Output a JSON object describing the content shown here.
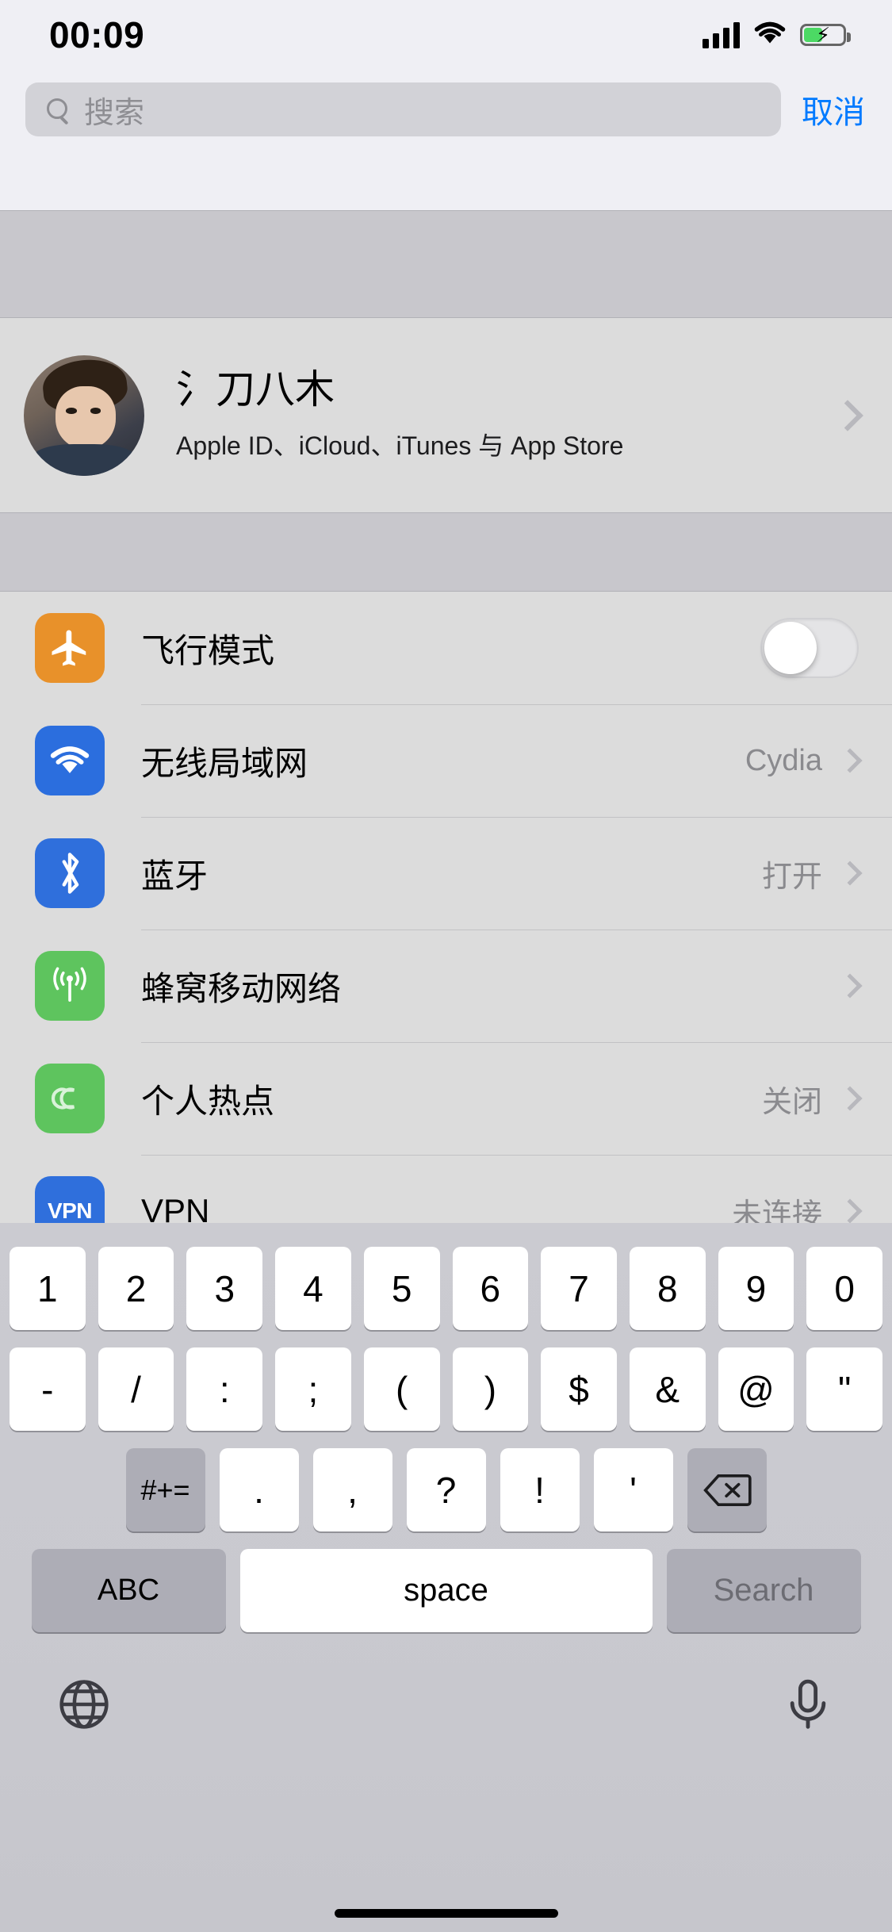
{
  "status_bar": {
    "time": "00:09",
    "signal_icon": "cellular-signal-icon",
    "wifi_icon": "wifi-icon",
    "battery_icon": "battery-charging-icon"
  },
  "search": {
    "placeholder": "搜索",
    "value": "",
    "cancel_label": "取消",
    "icon": "search-icon"
  },
  "profile": {
    "name": "氵刀八木",
    "subtitle": "Apple ID、iCloud、iTunes 与 App Store",
    "avatar": "user-avatar",
    "chevron": "chevron-right-icon"
  },
  "settings": {
    "rows": [
      {
        "label": "飞行模式",
        "value": "",
        "icon": "airplane-icon",
        "icon_color": "#e8912a",
        "control": "toggle",
        "toggle_on": false
      },
      {
        "label": "无线局域网",
        "value": "Cydia",
        "icon": "wifi-icon",
        "icon_color": "#2b6ede",
        "control": "chevron"
      },
      {
        "label": "蓝牙",
        "value": "打开",
        "icon": "bluetooth-icon",
        "icon_color": "#2f6fdc",
        "control": "chevron"
      },
      {
        "label": "蜂窝移动网络",
        "value": "",
        "icon": "cellular-icon",
        "icon_color": "#5ec45e",
        "control": "chevron"
      },
      {
        "label": "个人热点",
        "value": "关闭",
        "icon": "personal-hotspot-icon",
        "icon_color": "#5ec45e",
        "control": "chevron"
      },
      {
        "label": "VPN",
        "value": "未连接",
        "icon": "vpn-icon",
        "icon_color": "#2f6fdc",
        "icon_text": "VPN",
        "control": "chevron"
      }
    ]
  },
  "keyboard": {
    "layout": "numeric-symbols",
    "row1": [
      "1",
      "2",
      "3",
      "4",
      "5",
      "6",
      "7",
      "8",
      "9",
      "0"
    ],
    "row2": [
      "-",
      "/",
      ":",
      ";",
      "(",
      ")",
      "$",
      "&",
      "@",
      "\""
    ],
    "row3": {
      "shift_label": "#+=",
      "keys": [
        ".",
        ",",
        "?",
        "!",
        "'"
      ],
      "backspace_icon": "backspace-icon"
    },
    "row4": {
      "abc_label": "ABC",
      "space_label": "space",
      "return_label": "Search"
    },
    "bottom": {
      "globe_icon": "globe-icon",
      "mic_icon": "microphone-icon"
    }
  },
  "colors": {
    "accent": "#007aff",
    "page_bg": "#efeff4",
    "cell_bg": "#dcdcdc",
    "band_bg": "#c8c7cc",
    "keyboard_bg": "#cbcbd1",
    "value_text": "#8a8a8e"
  }
}
